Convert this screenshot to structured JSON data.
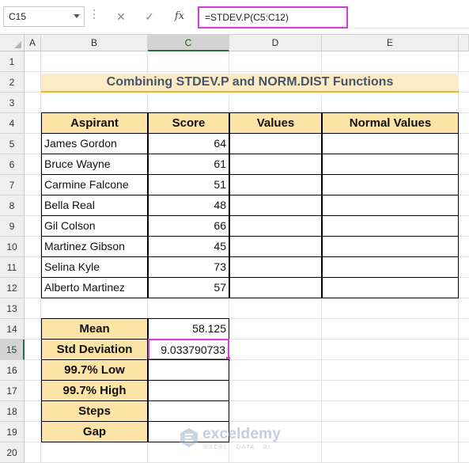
{
  "formula_bar": {
    "name_box": "C15",
    "cancel_glyph": "✕",
    "enter_glyph": "✓",
    "fx_label": "fx",
    "formula": "=STDEV.P(C5:C12)"
  },
  "columns": [
    "A",
    "B",
    "C",
    "D",
    "E"
  ],
  "active_column": "C",
  "rows": [
    "1",
    "2",
    "3",
    "4",
    "5",
    "6",
    "7",
    "8",
    "9",
    "10",
    "11",
    "12",
    "13",
    "14",
    "15",
    "16",
    "17",
    "18",
    "19",
    "20"
  ],
  "active_row": "15",
  "title": "Combining STDEV.P and NORM.DIST Functions",
  "table": {
    "headers": [
      "Aspirant",
      "Score",
      "Values",
      "Normal Values"
    ],
    "rows": [
      {
        "name": "James Gordon",
        "score": "64"
      },
      {
        "name": "Bruce Wayne",
        "score": "61"
      },
      {
        "name": "Carmine Falcone",
        "score": "51"
      },
      {
        "name": "Bella Real",
        "score": "48"
      },
      {
        "name": "Gil Colson",
        "score": "66"
      },
      {
        "name": "Martinez Gibson",
        "score": "45"
      },
      {
        "name": "Selina Kyle",
        "score": "73"
      },
      {
        "name": "Alberto Martinez",
        "score": "57"
      }
    ]
  },
  "stats": [
    {
      "label": "Mean",
      "value": "58.125"
    },
    {
      "label": "Std Deviation",
      "value": "9.033790733"
    },
    {
      "label": "99.7% Low",
      "value": ""
    },
    {
      "label": "99.7% High",
      "value": ""
    },
    {
      "label": "Steps",
      "value": ""
    },
    {
      "label": "Gap",
      "value": ""
    }
  ],
  "watermark": {
    "brand": "exceldemy",
    "tagline": "EXCEL · DATA · BI"
  },
  "colors": {
    "header_fill": "#fce4a6",
    "title_fill": "#fdebc6",
    "title_underline": "#f0b323",
    "selection": "#d63bd6"
  }
}
